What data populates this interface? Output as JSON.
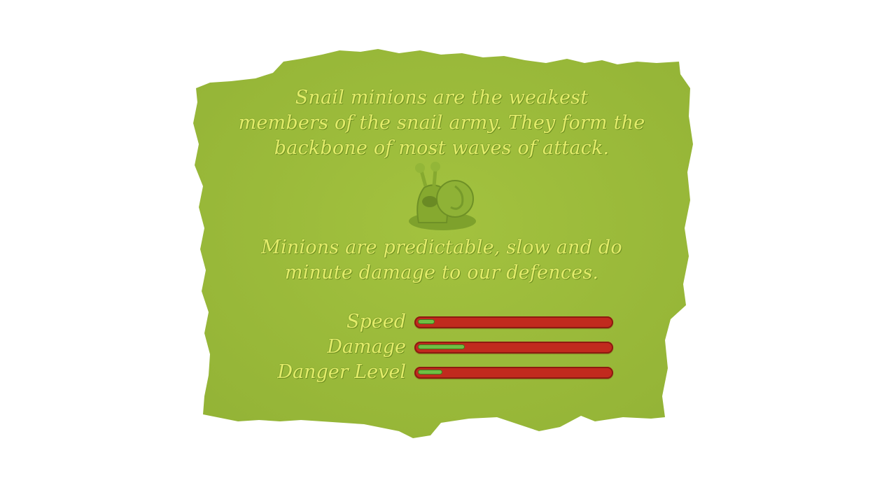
{
  "description": {
    "intro_lines": [
      "Snail minions are the weakest",
      "members of the snail army. They form the",
      "backbone of most waves of attack."
    ],
    "detail_lines": [
      "Minions are predictable, slow and do",
      "minute damage to our defences."
    ]
  },
  "unit_icon": "snail-minion-icon",
  "stats": [
    {
      "label": "Speed",
      "level": 0.08
    },
    {
      "label": "Damage",
      "level": 0.24
    },
    {
      "label": "Danger Level",
      "level": 0.12
    }
  ],
  "colors": {
    "paper": "#9bbb3b",
    "text": "#e3ec6a",
    "bar": "#c12a1e",
    "bar_fill": "#6fbf44"
  }
}
